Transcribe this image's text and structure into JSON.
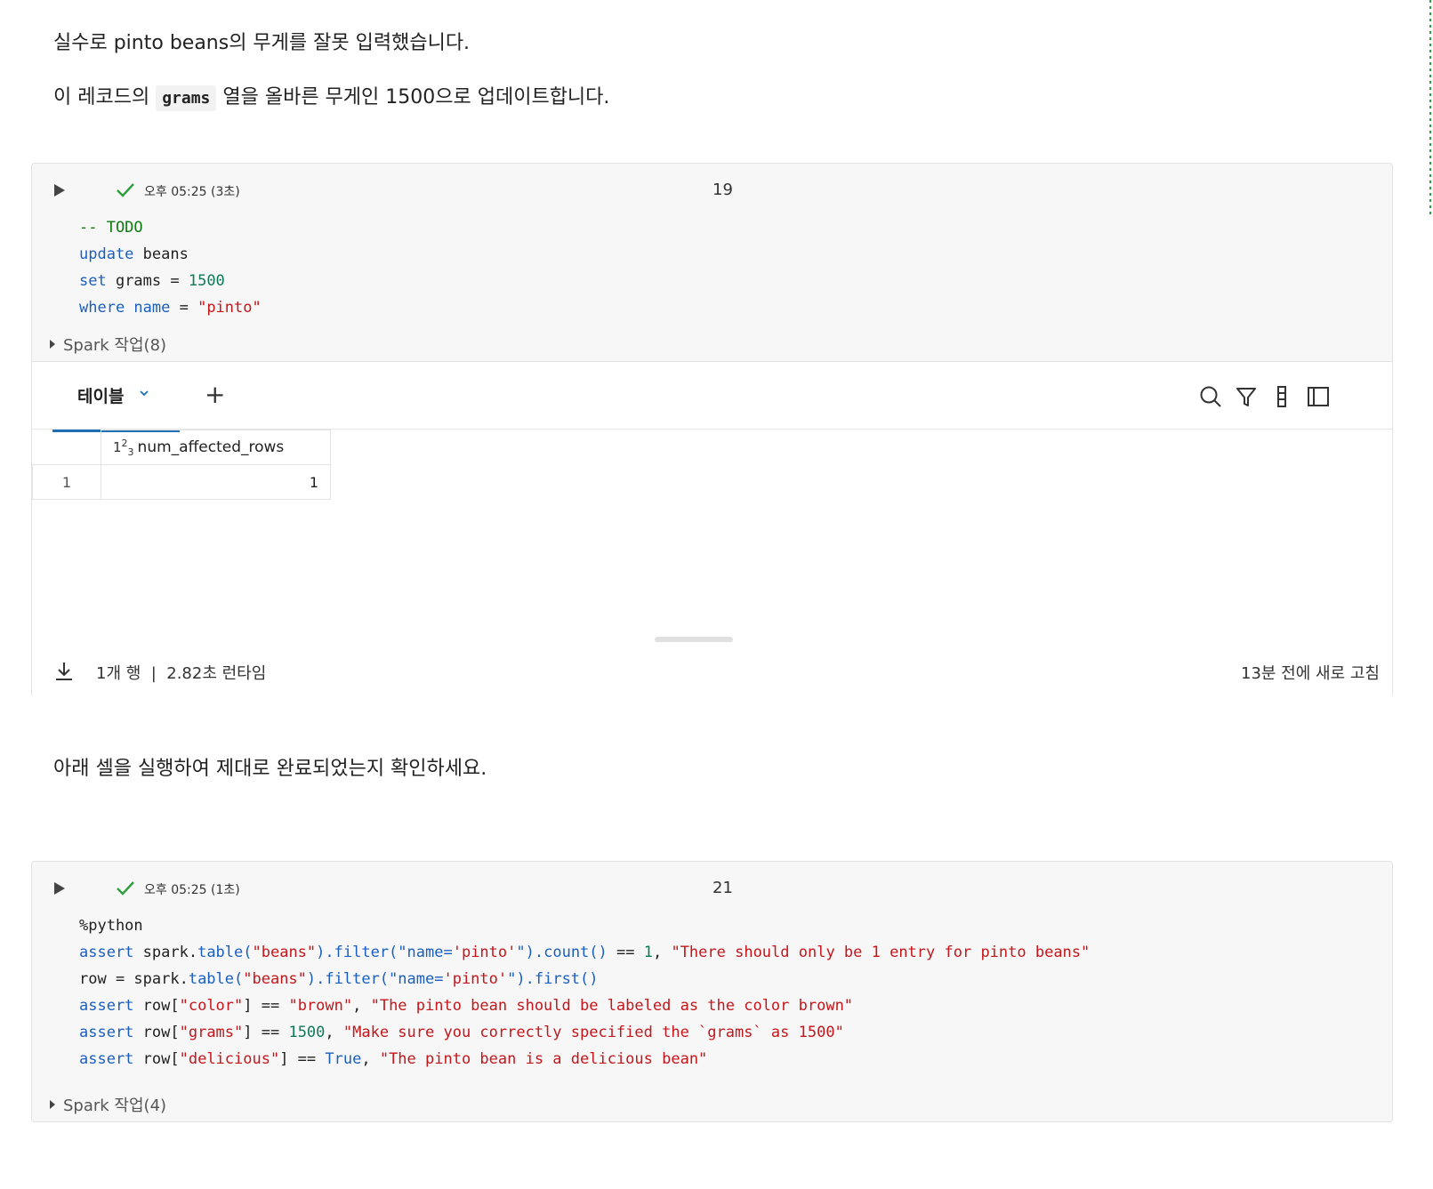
{
  "md1": {
    "line1": "실수로 pinto beans의 무게를 잘못 입력했습니다.",
    "line2_pre": "이 레코드의 ",
    "line2_code": "grams",
    "line2_post": " 열을 올바른 무게인 1500으로 업데이트합니다."
  },
  "cell1": {
    "exec_time": "오후 05:25 (3초)",
    "cmd_number": "19",
    "code": {
      "l1": "-- TODO",
      "l2_kw": "update",
      "l2_rest": " beans",
      "l3_kw": "set",
      "l3_mid": " grams = ",
      "l3_num": "1500",
      "l4_kw": "where name",
      "l4_mid": " = ",
      "l4_str": "\"pinto\""
    },
    "spark_jobs": "Spark 작업(8)",
    "results": {
      "tab_label": "테이블",
      "add_tab": "+",
      "column_header": "num_affected_rows",
      "row_index": "1",
      "row_value": "1",
      "footer_stats": "1개 행  |  2.82초 런타임",
      "footer_refresh": "13분 전에 새로 고침"
    }
  },
  "md2": {
    "text": "아래 셀을 실행하여 제대로 완료되었는지 확인하세요."
  },
  "cell2": {
    "exec_time": "오후 05:25 (1초)",
    "cmd_number": "21",
    "code": {
      "l1": "%python",
      "l2": {
        "kw": "assert",
        "a": " spark.",
        "b": "table(",
        "s1": "\"beans\"",
        "c": ").",
        "d": "filter(",
        "s2": "\"name=",
        "s3": "'pinto'",
        "s4": "\"",
        "e": ").",
        "f": "count()",
        "g": " == ",
        "n": "1",
        "h": ", ",
        "s5": "\"There should only be 1 entry for pinto beans\""
      },
      "l3": {
        "a": "row = spark.",
        "b": "table(",
        "s1": "\"beans\"",
        "c": ").",
        "d": "filter(",
        "s2": "\"name=",
        "s3": "'pinto'",
        "s4": "\"",
        "e": ").",
        "f": "first()"
      },
      "l4": {
        "kw": "assert",
        "a": " row[",
        "s1": "\"color\"",
        "b": "] == ",
        "s2": "\"brown\"",
        "c": ", ",
        "s3": "\"The pinto bean should be labeled as the color brown\""
      },
      "l5": {
        "kw": "assert",
        "a": " row[",
        "s1": "\"grams\"",
        "b": "] == ",
        "n": "1500",
        "c": ", ",
        "s3": "\"Make sure you correctly specified the `grams` as 1500\""
      },
      "l6": {
        "kw": "assert",
        "a": " row[",
        "s1": "\"delicious\"",
        "b": "] == ",
        "kw2": "True",
        "c": ", ",
        "s3": "\"The pinto bean is a delicious bean\""
      }
    },
    "spark_jobs": "Spark 작업(4)"
  },
  "colors": {
    "keyword": "#1a5fbf",
    "comment": "#107a10",
    "number": "#0f7a5a",
    "string": "#c4161b",
    "tab_accent": "#1f6fb5",
    "success_check": "#2e9e3e"
  },
  "icons": [
    "run-icon",
    "check-icon",
    "chevron-down-icon",
    "search-icon",
    "filter-icon",
    "column-icon",
    "sidebar-icon",
    "download-icon",
    "number-type-icon"
  ]
}
